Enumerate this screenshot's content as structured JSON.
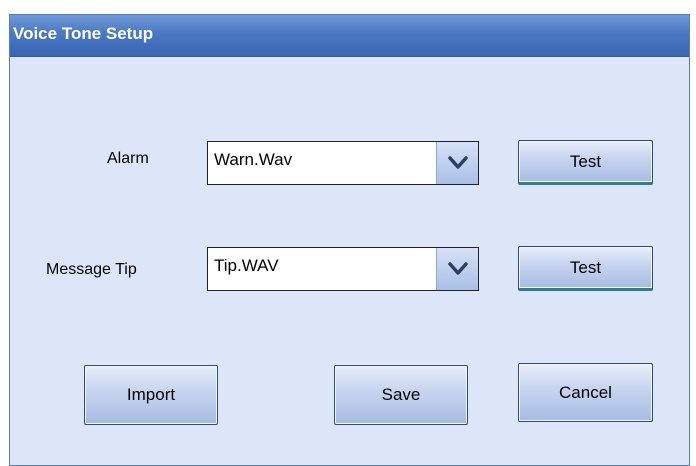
{
  "window": {
    "title": "Voice Tone Setup"
  },
  "fields": {
    "alarm": {
      "label": "Alarm",
      "value": "Warn.Wav",
      "test_label": "Test"
    },
    "message_tip": {
      "label": "Message Tip",
      "value": "Tip.WAV",
      "test_label": "Test"
    }
  },
  "buttons": {
    "import_label": "Import",
    "save_label": "Save",
    "cancel_label": "Cancel"
  },
  "icons": {
    "dropdown": "chevron-down-icon"
  },
  "colors": {
    "titlebar": "#4a78c2",
    "background": "#dde6f8",
    "button": "#c9d6f0"
  }
}
